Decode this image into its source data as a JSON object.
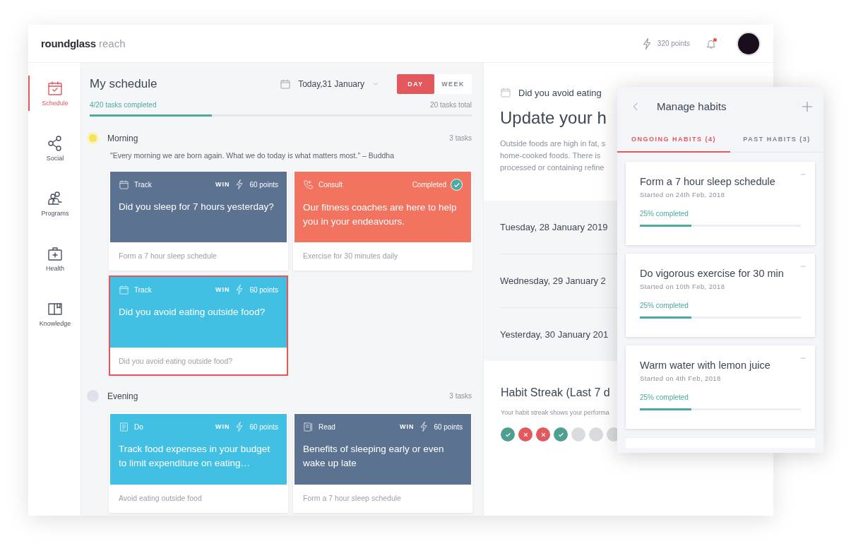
{
  "header": {
    "logo_bold": "roundglass",
    "logo_light": "reach",
    "points": "320 points",
    "notification_unread": true
  },
  "sidebar": {
    "items": [
      {
        "label": "Schedule",
        "kind": "schedule",
        "selected": true
      },
      {
        "label": "Social",
        "kind": "social",
        "selected": false
      },
      {
        "label": "Programs",
        "kind": "programs",
        "selected": false
      },
      {
        "label": "Health",
        "kind": "health",
        "selected": false
      },
      {
        "label": "Knowledge",
        "kind": "knowledge",
        "selected": false
      }
    ]
  },
  "schedule": {
    "title": "My schedule",
    "date": "Today,31 January",
    "views": [
      {
        "label": "DAY",
        "selected": true
      },
      {
        "label": "WEEK",
        "selected": false
      }
    ],
    "progress_text": "4/20 tasks completed",
    "total_text": "20 tasks total",
    "level": 0.32,
    "sections": [
      {
        "name": "Morning",
        "count": "3 tasks",
        "active": true,
        "quote": "\"Every morning we are born again. What we do today is what matters most.\" – Buddha",
        "tasks": [
          {
            "kind": "track",
            "label": "Track",
            "badge": {
              "kind": "win",
              "label": "WIN",
              "points": "60 points"
            },
            "title": "Did you sleep for 7 hours yesterday?",
            "footer": "Form a 7 hour sleep schedule",
            "color": "#5b7290",
            "selected": false
          },
          {
            "kind": "consult",
            "label": "Consult",
            "badge": {
              "kind": "completed",
              "label": "Completed"
            },
            "title": "Our fitness coaches are here to help you in your endeavours.",
            "footer": "Exercise for 30 minutes daily",
            "color": "#f2735f",
            "selected": false
          },
          {
            "kind": "track",
            "label": "Track",
            "badge": {
              "kind": "win",
              "label": "WIN",
              "points": "60 points"
            },
            "title": "Did you avoid eating outside food?",
            "footer": "Did you avoid eating outside food?",
            "color": "#41c0e3",
            "selected": true
          }
        ]
      },
      {
        "name": "Evening",
        "count": "3 tasks",
        "active": false,
        "tasks": [
          {
            "kind": "do",
            "label": "Do",
            "badge": {
              "kind": "win",
              "label": "WIN",
              "points": "60 points"
            },
            "title": "Track food expenses in your budget to limit expenditure on eating…",
            "footer": "Avoid eating outside food",
            "color": "#41c0e3",
            "selected": false
          },
          {
            "kind": "read",
            "label": "Read",
            "badge": {
              "kind": "win",
              "label": "WIN",
              "points": "60 points"
            },
            "title": "Benefits of sleeping early or even wake up late",
            "footer": "Form a 7 hour sleep schedule",
            "color": "#5b7290",
            "selected": false
          }
        ]
      }
    ]
  },
  "detail": {
    "question": "Did you avoid eating",
    "heading": "Update your h",
    "description_lines": [
      "Outside foods are high in fat, s",
      "home-cooked foods. There is",
      "processed or containing refine"
    ],
    "dates": [
      "Tuesday, 28 January 2019",
      "Wednesday, 29 January 2",
      "Yesterday, 30 January 201"
    ],
    "streak_title": "Habit Streak (Last 7 d",
    "streak_text": "Your habit streak shows your performa",
    "streak": [
      {
        "kind": "done"
      },
      {
        "kind": "missed"
      },
      {
        "kind": "missed"
      },
      {
        "kind": "done"
      },
      {
        "kind": "empty"
      },
      {
        "kind": "empty"
      },
      {
        "kind": "empty"
      }
    ]
  },
  "manage_habits": {
    "title": "Manage habits",
    "tabs": [
      {
        "label": "ONGOING HABITS (4)",
        "selected": true
      },
      {
        "label": "PAST HABITS (3)",
        "selected": false
      }
    ],
    "habits": [
      {
        "title": "Form a 7 hour sleep schedule",
        "started": "Started on 24th Feb, 2018",
        "progress_text": "25% completed",
        "level": 0.32
      },
      {
        "title": "Do vigorous exercise for 30 min",
        "started": "Started on 10th Feb, 2018",
        "progress_text": "25% completed",
        "level": 0.32
      },
      {
        "title": "Warm water with lemon juice",
        "started": "Started on 4th Feb, 2018",
        "progress_text": "25% completed",
        "level": 0.32
      }
    ]
  }
}
